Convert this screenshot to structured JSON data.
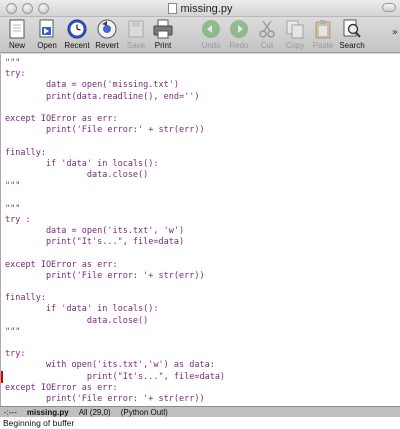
{
  "window": {
    "title": "missing.py"
  },
  "toolbar": {
    "buttons": [
      {
        "label": "New",
        "icon": "new-file-icon",
        "enabled": true
      },
      {
        "label": "Open",
        "icon": "open-folder-icon",
        "enabled": true
      },
      {
        "label": "Recent",
        "icon": "recent-clock-icon",
        "enabled": true
      },
      {
        "label": "Revert",
        "icon": "revert-icon",
        "enabled": true
      },
      {
        "label": "Save",
        "icon": "save-icon",
        "enabled": false
      },
      {
        "label": "Print",
        "icon": "print-icon",
        "enabled": true
      },
      {
        "label": "Undo",
        "icon": "undo-icon",
        "enabled": false
      },
      {
        "label": "Redo",
        "icon": "redo-icon",
        "enabled": false
      },
      {
        "label": "Cut",
        "icon": "cut-icon",
        "enabled": false
      },
      {
        "label": "Copy",
        "icon": "copy-icon",
        "enabled": false
      },
      {
        "label": "Paste",
        "icon": "paste-icon",
        "enabled": false
      },
      {
        "label": "Search",
        "icon": "search-icon",
        "enabled": true
      }
    ],
    "overflow": "»"
  },
  "editor": {
    "lines": [
      "\"\"\"",
      "try:",
      "        data = open('missing.txt')",
      "        print(data.readline(), end='')",
      "",
      "except IOError as err:",
      "        print('File error:' + str(err))",
      "",
      "finally:",
      "        if 'data' in locals():",
      "                data.close()",
      "\"\"\"",
      "",
      "\"\"\"",
      "try :",
      "        data = open('its.txt', 'w')",
      "        print(\"It's...\", file=data)",
      "",
      "except IOError as err:",
      "        print('File error: '+ str(err))",
      "",
      "finally:",
      "        if 'data' in locals():",
      "                data.close()",
      "\"\"\"",
      "",
      "try:",
      "        with open('its.txt','w') as data:",
      "                print(\"It's...\", file=data)",
      "except IOError as err:",
      "        print('File error: '+ str(err))"
    ],
    "fringe_line_index": 28
  },
  "modeline": {
    "flags": "-:---",
    "buffer": "missing.py",
    "position": "All (29,0)",
    "mode": "(Python Outl)"
  },
  "minibuffer": {
    "message": "Beginning of buffer"
  },
  "colors": {
    "code_text": "#7a2a7a",
    "fringe_marker": "#d00000"
  }
}
